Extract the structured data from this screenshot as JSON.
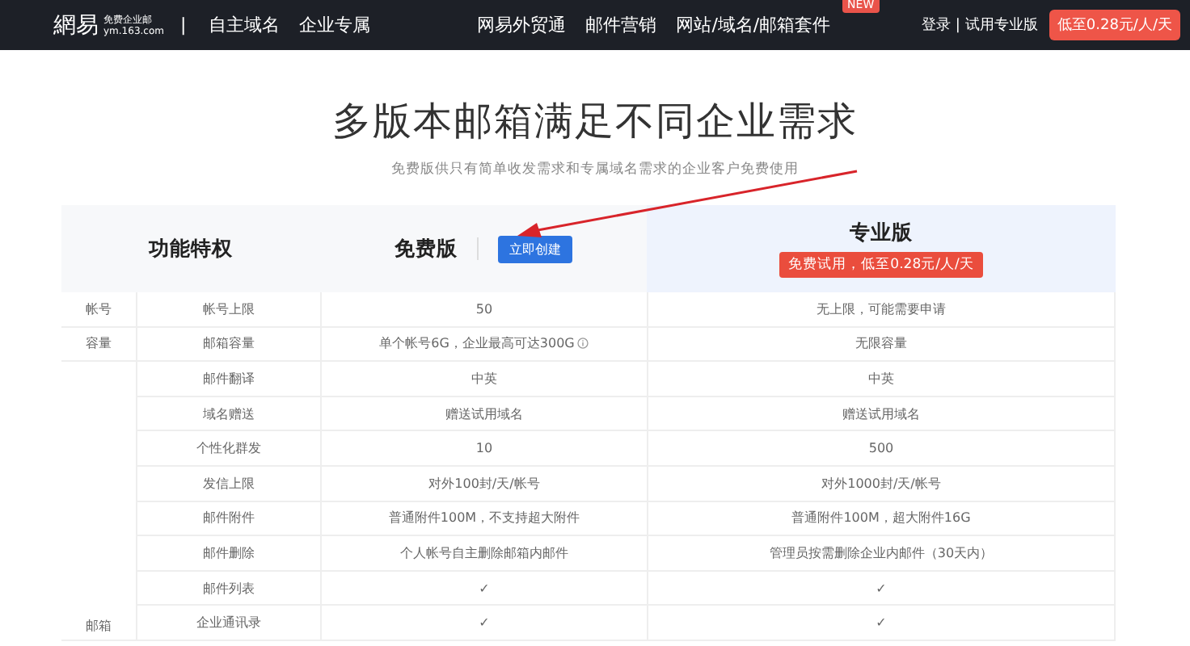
{
  "nav": {
    "logo": {
      "mark": "網易",
      "line1": "免费企业邮",
      "line2": "ym.163.com"
    },
    "separator": "|",
    "left_links": [
      "自主域名",
      "企业专属"
    ],
    "center_links": [
      {
        "label": "网易外贸通"
      },
      {
        "label": "邮件营销"
      },
      {
        "label": "网站/域名/邮箱套件",
        "badge": "NEW"
      }
    ],
    "login": "登录",
    "divider": "|",
    "trial": "试用专业版",
    "price_button": "低至0.28元/人/天"
  },
  "hero": {
    "title": "多版本邮箱满足不同企业需求",
    "subtitle": "免费版供只有简单收发需求和专属域名需求的企业客户免费使用"
  },
  "table": {
    "header": {
      "feature": "功能特权",
      "free": "免费版",
      "create_button": "立即创建",
      "pro": "专业版",
      "pro_badge": "免费试用，低至0.28元/人/天"
    },
    "groups": [
      {
        "label": "帐号",
        "rows": [
          {
            "feature": "帐号上限",
            "free": "50",
            "pro": "无上限，可能需要申请",
            "info": false
          }
        ]
      },
      {
        "label": "容量",
        "rows": [
          {
            "feature": "邮箱容量",
            "free": "单个帐号6G，企业最高可达300G",
            "pro": "无限容量",
            "info": true
          }
        ]
      },
      {
        "label": "邮箱",
        "rows": [
          {
            "feature": "邮件翻译",
            "free": "中英",
            "pro": "中英",
            "info": false
          },
          {
            "feature": "域名赠送",
            "free": "赠送试用域名",
            "pro": "赠送试用域名",
            "info": false
          },
          {
            "feature": "个性化群发",
            "free": "10",
            "pro": "500",
            "info": false
          },
          {
            "feature": "发信上限",
            "free": "对外100封/天/帐号",
            "pro": "对外1000封/天/帐号",
            "info": false
          },
          {
            "feature": "邮件附件",
            "free": "普通附件100M，不支持超大附件",
            "pro": "普通附件100M，超大附件16G",
            "info": false
          },
          {
            "feature": "邮件删除",
            "free": "个人帐号自主删除邮箱内邮件",
            "pro": "管理员按需删除企业内邮件（30天内）",
            "info": false
          },
          {
            "feature": "邮件列表",
            "free": "✓",
            "pro": "✓",
            "info": false
          },
          {
            "feature": "企业通讯录",
            "free": "✓",
            "pro": "✓",
            "info": false
          }
        ]
      }
    ]
  }
}
